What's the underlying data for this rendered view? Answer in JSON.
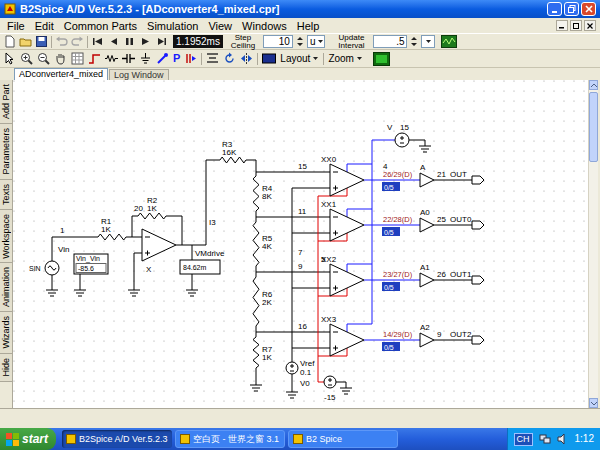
{
  "window": {
    "title": "B2Spice A/D Ver.5.2.3 - [ADconverter4_mixed.cpr]"
  },
  "menu": [
    "File",
    "Edit",
    "Common Parts",
    "Simulation",
    "View",
    "Windows",
    "Help"
  ],
  "toolbar": {
    "time": "1.1952ms",
    "step_label": "Step Ceiling",
    "step_value": "10",
    "step_unit": "u",
    "update_label": "Update Interval",
    "update_value": ".5"
  },
  "toolbar2": {
    "glyph": "P",
    "layout": "Layout",
    "zoom": "Zoom"
  },
  "tabs": [
    {
      "label": "ADconverter4_mixed",
      "selected": true
    },
    {
      "label": "Log Window",
      "selected": false
    }
  ],
  "side_tabs": [
    {
      "label": "Add Part",
      "selected": false
    },
    {
      "label": "Parameters",
      "selected": false
    },
    {
      "label": "Texts",
      "selected": false
    },
    {
      "label": "Workspace",
      "selected": false
    },
    {
      "label": "Animation",
      "selected": false
    },
    {
      "label": "Wizards",
      "selected": false
    },
    {
      "label": "Hide",
      "selected": false
    }
  ],
  "schematic": {
    "input_source": {
      "name": "Vin",
      "type_label": "SIN",
      "probe": "Vin_Vin",
      "reading": "-85.6",
      "node": "1"
    },
    "opamp": {
      "name": "X",
      "node": "20"
    },
    "meter": {
      "name": "VMdrive",
      "reading": "84.62m"
    },
    "resistors": [
      {
        "name": "R1",
        "value": "1K"
      },
      {
        "name": "R2",
        "value": "1K"
      },
      {
        "name": "R3",
        "value": "16K"
      },
      {
        "name": "R4",
        "value": "8K"
      },
      {
        "name": "R5",
        "value": "4K"
      },
      {
        "name": "R6",
        "value": "2K"
      },
      {
        "name": "R7",
        "value": "1K"
      }
    ],
    "nets": [
      "I3",
      "15",
      "11",
      "7",
      "9",
      "5",
      "16"
    ],
    "vref": {
      "name": "Vref",
      "value": "0.1"
    },
    "supplies": [
      {
        "name": "V",
        "value": "15"
      },
      {
        "name": "V0",
        "value": "-15"
      }
    ],
    "comparators": [
      {
        "name": "XX0",
        "node": "4",
        "state": "26/29(D)",
        "logic": "0/5"
      },
      {
        "name": "XX1",
        "state": "22/28(D)",
        "logic": "0/5"
      },
      {
        "name": "XX2",
        "state": "23/27(D)",
        "logic": "0/5"
      },
      {
        "name": "XX3",
        "state": "14/29(D)",
        "logic": "0/5"
      }
    ],
    "buffers": [
      {
        "name": "A",
        "node": "21",
        "output": "OUT"
      },
      {
        "name": "A0",
        "node": "25",
        "output": "OUT0"
      },
      {
        "name": "A1",
        "node": "26",
        "output": "OUT1"
      },
      {
        "name": "A2",
        "node": "9",
        "output": "OUT2"
      }
    ]
  },
  "taskbar": {
    "start": "start",
    "buttons": [
      {
        "label": "B2Spice A/D Ver.5.2.3",
        "selected": true
      },
      {
        "label": "空白页 - 世界之窗 3.1",
        "selected": false
      },
      {
        "label": "B2 Spice",
        "selected": false
      }
    ],
    "lang": "CH",
    "clock": "1:12"
  }
}
